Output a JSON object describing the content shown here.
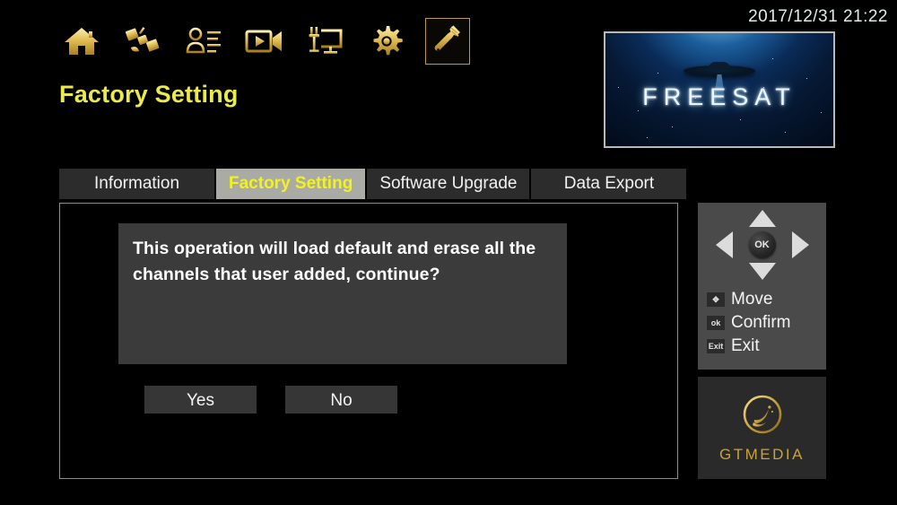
{
  "clock": "2017/12/31  21:22",
  "page_title": "Factory Setting",
  "nav_icons": [
    {
      "name": "home-icon",
      "label": "Home",
      "selected": false
    },
    {
      "name": "satellite-icon",
      "label": "Satellite",
      "selected": false
    },
    {
      "name": "user-list-icon",
      "label": "Channel List",
      "selected": false
    },
    {
      "name": "video-camera-icon",
      "label": "Media",
      "selected": false
    },
    {
      "name": "monitor-plug-icon",
      "label": "Network",
      "selected": false
    },
    {
      "name": "gear-icon",
      "label": "Settings",
      "selected": false
    },
    {
      "name": "wrench-icon",
      "label": "Tools",
      "selected": true
    }
  ],
  "preview": {
    "brand": "FREESAT"
  },
  "tabs": [
    {
      "label": "Information",
      "active": false
    },
    {
      "label": "Factory Setting",
      "active": true
    },
    {
      "label": "Software Upgrade",
      "active": false
    },
    {
      "label": "Data Export",
      "active": false
    }
  ],
  "dialog": {
    "message": "This operation will load default and erase all the channels that user added, continue?",
    "yes_label": "Yes",
    "no_label": "No"
  },
  "help_panel": {
    "ok_label": "OK",
    "legend": [
      {
        "badge": "✥",
        "label": "Move",
        "icon": "dpad-badge-icon"
      },
      {
        "badge": "ok",
        "label": "Confirm",
        "icon": "ok-badge-icon"
      },
      {
        "badge": "Exit",
        "label": "Exit",
        "icon": "exit-badge-icon"
      }
    ]
  },
  "logo": {
    "text": "GTMEDIA"
  },
  "colors": {
    "accent_gold": "#d9b64a",
    "title_yellow": "#eaea4a",
    "tab_active_bg": "#a9aba4",
    "tab_active_text": "#f2f21f",
    "panel_gray": "#4a4a4a",
    "message_bg": "#3b3b3b",
    "clock_text": "#dfeee4"
  }
}
